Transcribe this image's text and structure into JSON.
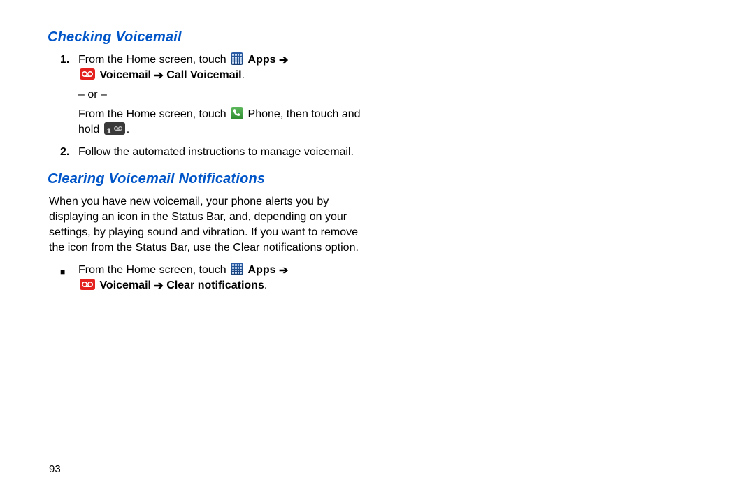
{
  "headings": {
    "checking": "Checking Voicemail",
    "clearing": "Clearing Voicemail Notifications"
  },
  "steps": {
    "s1_num": "1.",
    "s1_lead": "From the Home screen, touch ",
    "apps_label": "Apps ",
    "arrow": "➔",
    "voicemail_label": " Voicemail ",
    "call_vm": " Call Voicemail",
    "or": "– or –",
    "s1b_lead": "From the Home screen, touch ",
    "phone_label": " Phone",
    "s1b_mid": ", then touch and hold ",
    "period": ".",
    "s2_num": "2.",
    "s2_body": "Follow the automated instructions to manage voicemail."
  },
  "clearing": {
    "para": "When you have new voicemail, your phone alerts you by displaying an icon in the Status Bar, and, depending on your settings, by playing sound and vibration. If you want to remove the icon from the Status Bar, use the Clear notifications option.",
    "bullet_mark": "■",
    "b_lead": "From the Home screen, touch ",
    "clear_notif": " Clear notifications"
  },
  "page_number": "93",
  "icons": {
    "apps": "apps-icon",
    "voicemail": "voicemail-icon",
    "phone": "phone-icon",
    "key1": "key-1-icon"
  }
}
